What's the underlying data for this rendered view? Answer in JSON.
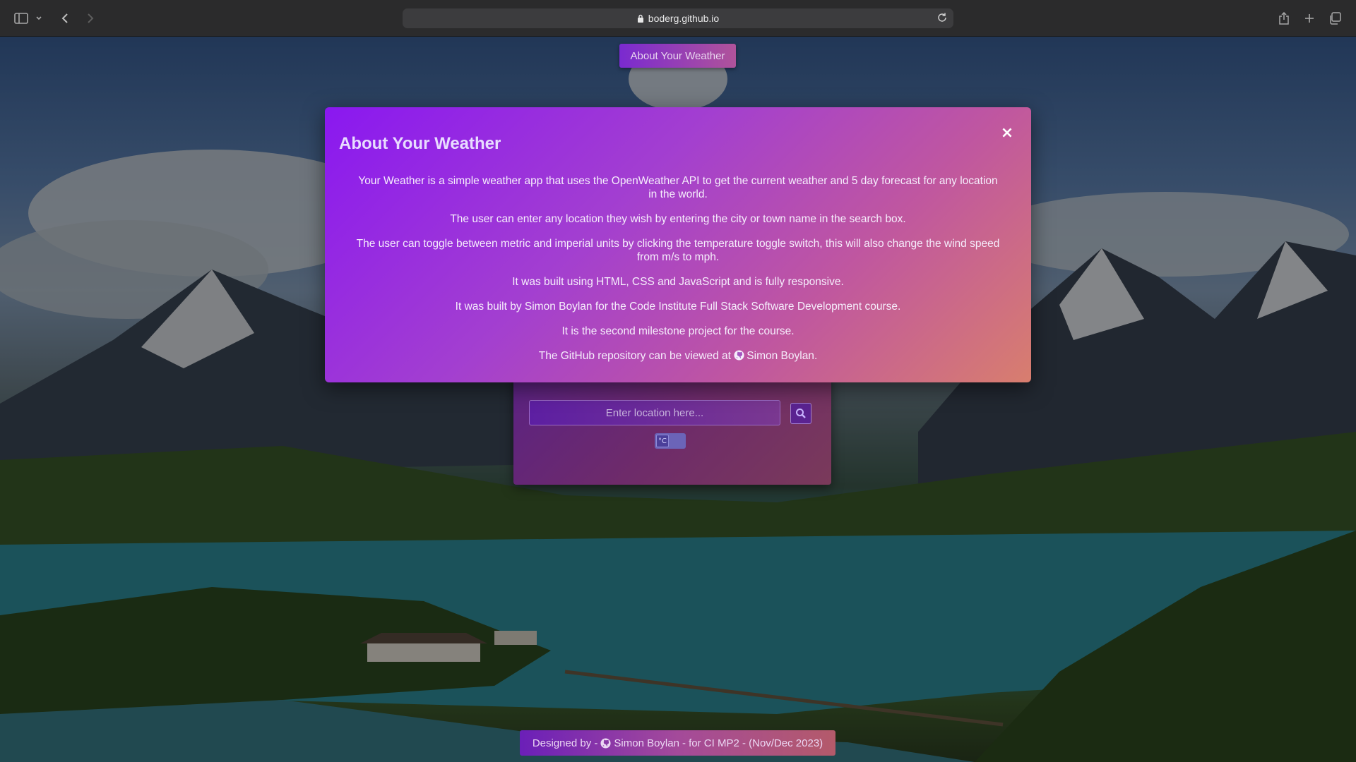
{
  "browser": {
    "url": "boderg.github.io",
    "icons": [
      "sidebar-icon",
      "chevron-down-icon",
      "back-icon",
      "forward-icon",
      "lock-icon",
      "reload-icon",
      "share-icon",
      "new-tab-icon",
      "tabs-overview-icon"
    ]
  },
  "header": {
    "about_label": "About Your Weather"
  },
  "modal": {
    "title": "About Your Weather",
    "close_label": "×",
    "paragraphs": [
      "Your Weather is a simple weather app that uses the OpenWeather API to get the current weather and 5 day forecast for any location in the world.",
      "The user can enter any location they wish by entering the city or town name in the search box.",
      "The user can toggle between metric and imperial units by clicking the temperature toggle switch, this will also change the wind speed from m/s to mph.",
      "It was built using HTML, CSS and JavaScript and is fully responsive.",
      "It was built by Simon Boylan for the Code Institute Full Stack Software Development course.",
      "It is the second milestone project for the course."
    ],
    "github_prefix": "The GitHub repository can be viewed at",
    "github_link": "Simon Boylan",
    "github_suffix": "."
  },
  "search": {
    "placeholder": "Enter location here...",
    "value": ""
  },
  "toggle": {
    "label": "°C"
  },
  "footer": {
    "prefix": "Designed by -",
    "author": "Simon Boylan",
    "suffix": "- for CI MP2 - (Nov/Dec 2023)"
  },
  "colors": {
    "modal_start": "#8a18f0",
    "modal_end": "#d87e6e",
    "browser_chrome": "#2b2b2c"
  }
}
